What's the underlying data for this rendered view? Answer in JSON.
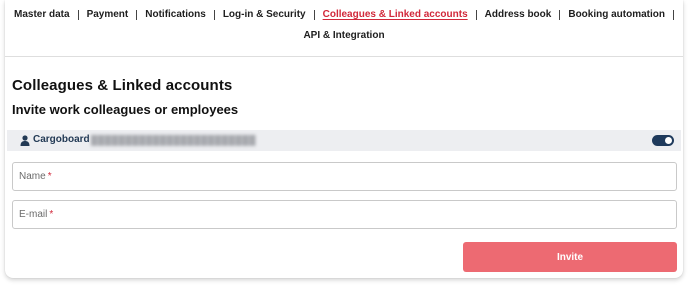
{
  "nav": {
    "items": [
      {
        "label": "Master data"
      },
      {
        "label": "Payment"
      },
      {
        "label": "Notifications"
      },
      {
        "label": "Log-in & Security"
      },
      {
        "label": "Colleagues & Linked accounts"
      },
      {
        "label": "Address book"
      },
      {
        "label": "Booking automation"
      }
    ],
    "second_row_label": "API & Integration",
    "active_index": 4,
    "active_color": "#d1283a"
  },
  "page": {
    "title": "Colleagues & Linked accounts",
    "section_title": "Invite work colleagues or employees"
  },
  "account": {
    "icon": "person-icon",
    "name": "Cargoboard",
    "id_redacted": "████████████████████████",
    "toggle_on": true
  },
  "form": {
    "name_label": "Name",
    "email_label": "E-mail",
    "required_mark": "*",
    "invite_label": "Invite"
  },
  "colors": {
    "accent": "#d1283a",
    "button": "#ed6a72",
    "toggle": "#1f3a5c",
    "bar": "#edeef1"
  }
}
